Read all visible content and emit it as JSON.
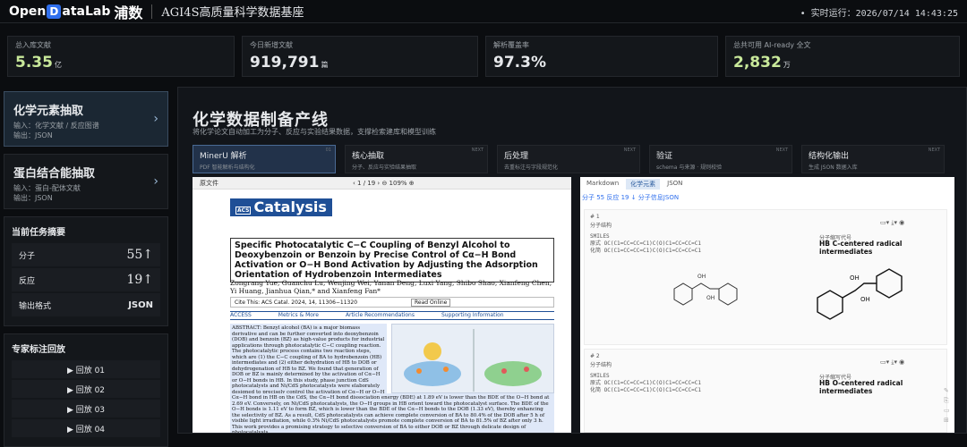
{
  "header": {
    "brand_a": "Open",
    "brand_d": "D",
    "brand_b": "ataLab",
    "brand_zh": "浦数",
    "title": "AGI4S高质量科学数据基座",
    "clock": "• 实时运行：2026/07/14 14:43:25"
  },
  "stats": [
    {
      "label": "总入库文献",
      "value": "5.35",
      "unit": "亿"
    },
    {
      "label": "今日新增文献",
      "value": "919,791",
      "unit": "篇"
    },
    {
      "label": "解析覆盖率",
      "value": "97.3%",
      "unit": ""
    },
    {
      "label": "总共可用 AI-ready 全文",
      "value": "2,832",
      "unit": "万"
    }
  ],
  "sidebar": {
    "cards": [
      {
        "title": "化学元素抽取",
        "line1": "输入：化学文献 / 反应图谱",
        "line2": "输出：JSON"
      },
      {
        "title": "蛋白结合能抽取",
        "line1": "输入：蛋白-配体文献",
        "line2": "输出：JSON"
      }
    ],
    "summary": {
      "title": "当前任务摘要",
      "rows": [
        {
          "label": "分子",
          "value": "55↑"
        },
        {
          "label": "反应",
          "value": "19↑"
        },
        {
          "label": "输出格式",
          "value": "JSON"
        }
      ]
    },
    "playback": {
      "title": "专家标注回放",
      "items": [
        "▶ 回放 01",
        "▶ 回放 02",
        "▶ 回放 03",
        "▶ 回放 04"
      ]
    }
  },
  "main": {
    "title": "化学数据制备产线",
    "subtitle": "将化学论文自动加工为分子、反应与实验结果数据，支撑检索建库和模型训练",
    "steps": [
      {
        "name": "MinerU 解析",
        "desc": "PDF 智能解析与结构化",
        "num": "01"
      },
      {
        "name": "核心抽取",
        "desc": "分子、反应与实验结果抽取",
        "num": "NEXT"
      },
      {
        "name": "后处理",
        "desc": "去重标注与字段规范化",
        "num": "NEXT"
      },
      {
        "name": "验证",
        "desc": "schema 与来源 · 规则校验",
        "num": "NEXT"
      },
      {
        "name": "结构化输出",
        "desc": "生成 JSON 数据入库",
        "num": "NEXT"
      }
    ]
  },
  "pdf": {
    "label": "原文件",
    "pager": "‹ 1 / 19 › ⊖ 109% ⊕",
    "journal": "Catalysis",
    "journal_prefix": "ACS",
    "title": "Specific Photocatalytic C−C Coupling of Benzyl Alcohol to Deoxybenzoin or Benzoin by Precise Control of Cα−H Bond Activation or O−H Bond Activation by Adjusting the Adsorption Orientation of Hydrobenzoin Intermediates",
    "authors": "Zongrang Yue, Guanchu Lu, Wenjing Wei, Yanan Deng, Luxi Yang, Shibo Shao, Xianfeng Chen, Yi Huang, Jianhua Qian,* and Xianfeng Fan*",
    "cite": "Cite This: ACS Catal. 2024, 14, 11306−11320",
    "read_online": "Read Online",
    "access": "ACCESS",
    "metrics": "Metrics & More",
    "recs": "Article Recommendations",
    "support": "Supporting Information",
    "abstract": "ABSTRACT: Benzyl alcohol (BA) is a major biomass derivative and can be further converted into deoxybenzoin (DOB) and benzoin (BZ) as high-value products for industrial applications through photocatalytic C−C coupling reaction. The photocatalytic process contains two reaction steps, which are (1) the C−C coupling of BA to hydrobenzoin (HB) intermediates and (2) either dehydration of HB to DOB or dehydrogenation of HB to BZ. We found that generation of DOB or BZ is mainly determined by the activation of Cα−H or O−H bonds in HB. In this study, phase junction CdS photocatalysts and Ni/CdS photocatalysts were elaborately designed to precisely control the activation of Cα−H or O−H bonds in HB by adjusting the adsorption orientation of HB on the photocatalyst surface.",
    "abstract_cont": "Cα−H bond in HB on the CdS, the Cα−H bond dissociation energy (BDE) at 1.89 eV is lower than the BDE of the O−H bond at 2.69 eV. Conversely, on Ni/CdS photocatalysts, the O−H groups in HB orient toward the photocatalyst surface. The BDE of the O−H bonds is 1.11 eV to form BZ, which is lower than the BDE of the Cα−H bonds to the DOB (1.33 eV), thereby enhancing the selectivity of BZ. As a result, CdS photocatalysts can achieve complete conversion of BA to 80.4% of the DOB after 5 h of visible light irradiation, while 0.3% Ni/CdS photocatalysts promote complete conversion of BA to 81.5% of BZ after only 3 h. This work provides a promising strategy to selective conversion of BA to either DOB or BZ through delicate design of photocatalysts."
  },
  "right": {
    "tabs": [
      "Markdown",
      "化学元素",
      "JSON"
    ],
    "sub": "分子 55   反应 19   ↓ 分子信息JSON",
    "records": [
      {
        "no": "# 1",
        "kind": "分子结构",
        "smiles_label": "SMILES",
        "l1": "原式     OC(C1=CC=CC=C1)C(O)C1=CC=CC=C1",
        "l2": "化简     OC(C1=CC=CC=C1)C(O)C1=CC=CC=C1",
        "name_label": "分子缩写代号",
        "name": "HB C-centered radical intermediates"
      },
      {
        "no": "# 2",
        "kind": "分子结构",
        "smiles_label": "SMILES",
        "l1": "原式     OC(C1=CC=CC=C1)C(O)C1=CC=CC=C1",
        "l2": "化简     OC(C1=CC=CC=C1)C(O)C1=CC=CC=C1",
        "name_label": "分子缩写代号",
        "name": "HB O-centered radical intermediates"
      }
    ],
    "icons": "▭▾   ⤓▾   ◉"
  },
  "colors": {
    "accent": "#2f6fed",
    "value_green": "#c8e89a",
    "bg": "#0b0d10",
    "panel": "#14171b"
  }
}
